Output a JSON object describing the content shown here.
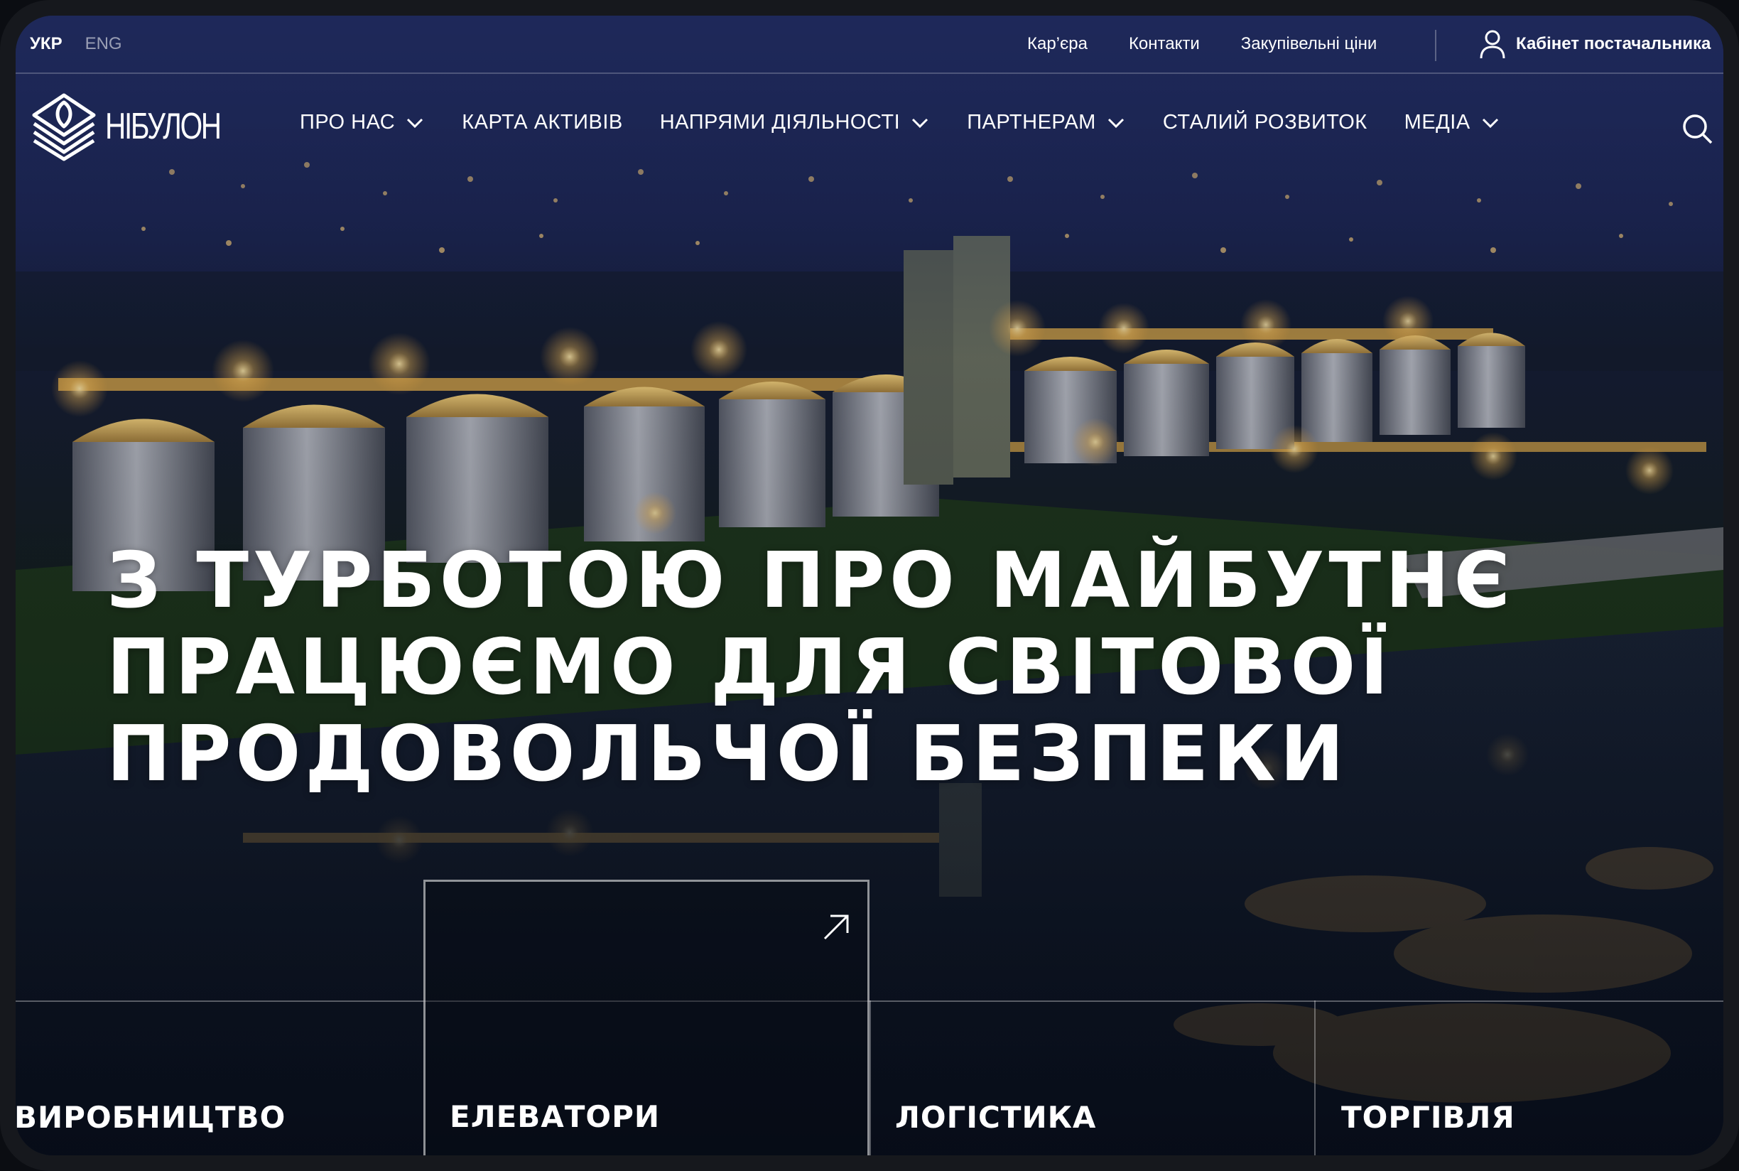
{
  "lang": {
    "ukr": "УКР",
    "eng": "ENG"
  },
  "utility_links": [
    "Кар’єра",
    "Контакти",
    "Закупівельні ціни"
  ],
  "cabinet_label": "Кабінет постачальника",
  "logo_text": "НІБУЛОН",
  "nav": [
    {
      "label": "ПРО НАС",
      "dropdown": true
    },
    {
      "label": "КАРТА АКТИВІВ",
      "dropdown": false
    },
    {
      "label": "НАПРЯМИ ДІЯЛЬНОСТІ",
      "dropdown": true
    },
    {
      "label": "ПАРТНЕРАМ",
      "dropdown": true
    },
    {
      "label": "СТАЛИЙ РОЗВИТОК",
      "dropdown": false
    },
    {
      "label": "МЕДІА",
      "dropdown": true
    }
  ],
  "hero": {
    "line1": "З ТУРБОТОЮ ПРО МАЙБУТНЄ",
    "line2": "ПРАЦЮЄМО ДЛЯ СВІТОВОЇ",
    "line3": "ПРОДОВОЛЬЧОЇ БЕЗПЕКИ"
  },
  "cards": [
    {
      "label": "ВИРОБНИЦТВО"
    },
    {
      "label": "ЕЛЕВАТОРИ"
    },
    {
      "label": "ЛОГІСТИКА"
    },
    {
      "label": "ТОРГІВЛЯ"
    }
  ],
  "icons": {
    "user": "user-icon",
    "search": "search-icon",
    "chevron": "chevron-down-icon",
    "arrow": "arrow-up-right-icon"
  }
}
